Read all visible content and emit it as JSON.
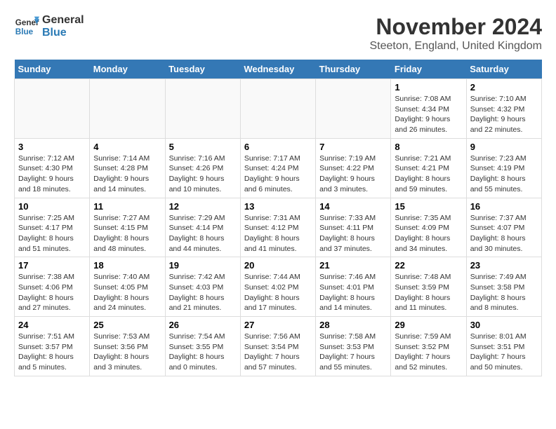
{
  "header": {
    "logo_line1": "General",
    "logo_line2": "Blue",
    "month": "November 2024",
    "location": "Steeton, England, United Kingdom"
  },
  "weekdays": [
    "Sunday",
    "Monday",
    "Tuesday",
    "Wednesday",
    "Thursday",
    "Friday",
    "Saturday"
  ],
  "weeks": [
    [
      {
        "day": "",
        "info": ""
      },
      {
        "day": "",
        "info": ""
      },
      {
        "day": "",
        "info": ""
      },
      {
        "day": "",
        "info": ""
      },
      {
        "day": "",
        "info": ""
      },
      {
        "day": "1",
        "info": "Sunrise: 7:08 AM\nSunset: 4:34 PM\nDaylight: 9 hours and 26 minutes."
      },
      {
        "day": "2",
        "info": "Sunrise: 7:10 AM\nSunset: 4:32 PM\nDaylight: 9 hours and 22 minutes."
      }
    ],
    [
      {
        "day": "3",
        "info": "Sunrise: 7:12 AM\nSunset: 4:30 PM\nDaylight: 9 hours and 18 minutes."
      },
      {
        "day": "4",
        "info": "Sunrise: 7:14 AM\nSunset: 4:28 PM\nDaylight: 9 hours and 14 minutes."
      },
      {
        "day": "5",
        "info": "Sunrise: 7:16 AM\nSunset: 4:26 PM\nDaylight: 9 hours and 10 minutes."
      },
      {
        "day": "6",
        "info": "Sunrise: 7:17 AM\nSunset: 4:24 PM\nDaylight: 9 hours and 6 minutes."
      },
      {
        "day": "7",
        "info": "Sunrise: 7:19 AM\nSunset: 4:22 PM\nDaylight: 9 hours and 3 minutes."
      },
      {
        "day": "8",
        "info": "Sunrise: 7:21 AM\nSunset: 4:21 PM\nDaylight: 8 hours and 59 minutes."
      },
      {
        "day": "9",
        "info": "Sunrise: 7:23 AM\nSunset: 4:19 PM\nDaylight: 8 hours and 55 minutes."
      }
    ],
    [
      {
        "day": "10",
        "info": "Sunrise: 7:25 AM\nSunset: 4:17 PM\nDaylight: 8 hours and 51 minutes."
      },
      {
        "day": "11",
        "info": "Sunrise: 7:27 AM\nSunset: 4:15 PM\nDaylight: 8 hours and 48 minutes."
      },
      {
        "day": "12",
        "info": "Sunrise: 7:29 AM\nSunset: 4:14 PM\nDaylight: 8 hours and 44 minutes."
      },
      {
        "day": "13",
        "info": "Sunrise: 7:31 AM\nSunset: 4:12 PM\nDaylight: 8 hours and 41 minutes."
      },
      {
        "day": "14",
        "info": "Sunrise: 7:33 AM\nSunset: 4:11 PM\nDaylight: 8 hours and 37 minutes."
      },
      {
        "day": "15",
        "info": "Sunrise: 7:35 AM\nSunset: 4:09 PM\nDaylight: 8 hours and 34 minutes."
      },
      {
        "day": "16",
        "info": "Sunrise: 7:37 AM\nSunset: 4:07 PM\nDaylight: 8 hours and 30 minutes."
      }
    ],
    [
      {
        "day": "17",
        "info": "Sunrise: 7:38 AM\nSunset: 4:06 PM\nDaylight: 8 hours and 27 minutes."
      },
      {
        "day": "18",
        "info": "Sunrise: 7:40 AM\nSunset: 4:05 PM\nDaylight: 8 hours and 24 minutes."
      },
      {
        "day": "19",
        "info": "Sunrise: 7:42 AM\nSunset: 4:03 PM\nDaylight: 8 hours and 21 minutes."
      },
      {
        "day": "20",
        "info": "Sunrise: 7:44 AM\nSunset: 4:02 PM\nDaylight: 8 hours and 17 minutes."
      },
      {
        "day": "21",
        "info": "Sunrise: 7:46 AM\nSunset: 4:01 PM\nDaylight: 8 hours and 14 minutes."
      },
      {
        "day": "22",
        "info": "Sunrise: 7:48 AM\nSunset: 3:59 PM\nDaylight: 8 hours and 11 minutes."
      },
      {
        "day": "23",
        "info": "Sunrise: 7:49 AM\nSunset: 3:58 PM\nDaylight: 8 hours and 8 minutes."
      }
    ],
    [
      {
        "day": "24",
        "info": "Sunrise: 7:51 AM\nSunset: 3:57 PM\nDaylight: 8 hours and 5 minutes."
      },
      {
        "day": "25",
        "info": "Sunrise: 7:53 AM\nSunset: 3:56 PM\nDaylight: 8 hours and 3 minutes."
      },
      {
        "day": "26",
        "info": "Sunrise: 7:54 AM\nSunset: 3:55 PM\nDaylight: 8 hours and 0 minutes."
      },
      {
        "day": "27",
        "info": "Sunrise: 7:56 AM\nSunset: 3:54 PM\nDaylight: 7 hours and 57 minutes."
      },
      {
        "day": "28",
        "info": "Sunrise: 7:58 AM\nSunset: 3:53 PM\nDaylight: 7 hours and 55 minutes."
      },
      {
        "day": "29",
        "info": "Sunrise: 7:59 AM\nSunset: 3:52 PM\nDaylight: 7 hours and 52 minutes."
      },
      {
        "day": "30",
        "info": "Sunrise: 8:01 AM\nSunset: 3:51 PM\nDaylight: 7 hours and 50 minutes."
      }
    ]
  ]
}
